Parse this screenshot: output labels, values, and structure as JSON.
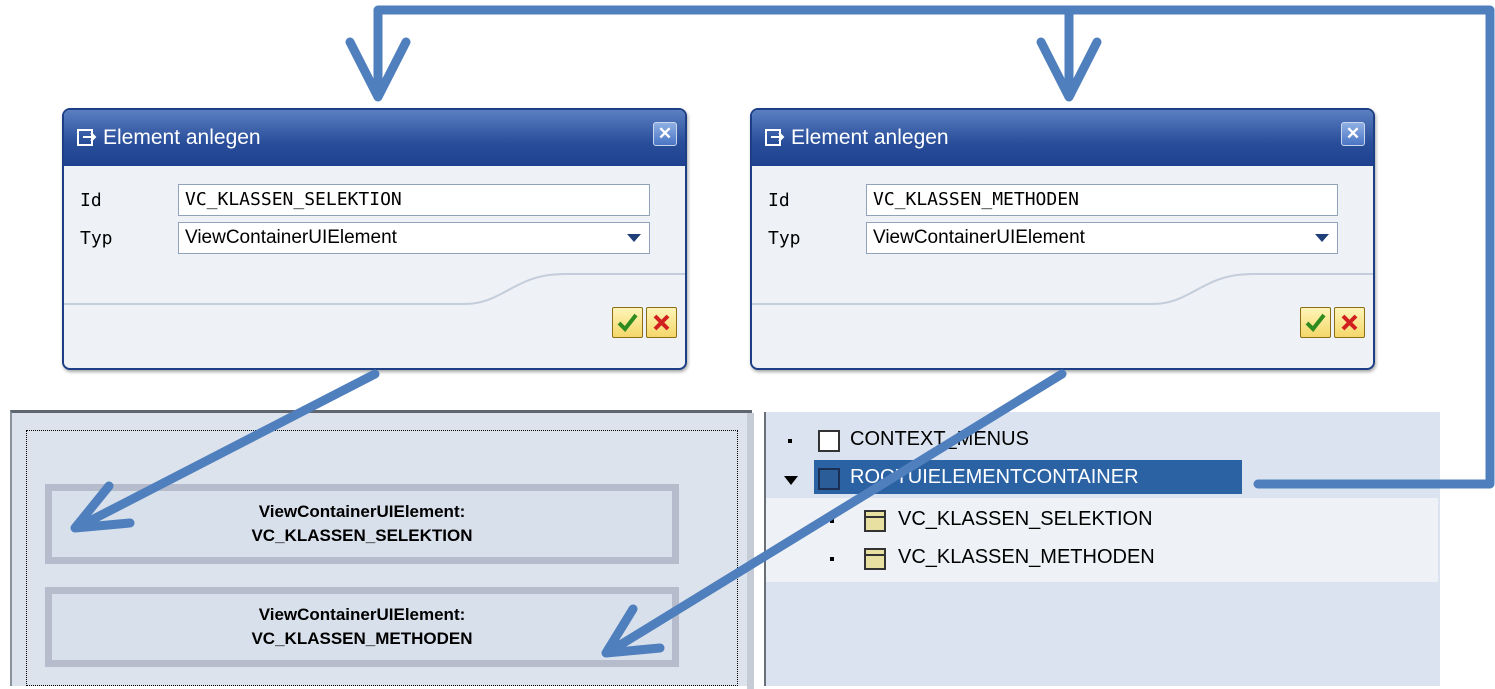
{
  "dialogs": [
    {
      "title": "Element anlegen",
      "close_glyph": "✕",
      "id_label": "Id",
      "id_value": "VC_KLASSEN_SELEKTION",
      "type_label": "Typ",
      "type_value": "ViewContainerUIElement"
    },
    {
      "title": "Element anlegen",
      "close_glyph": "✕",
      "id_label": "Id",
      "id_value": "VC_KLASSEN_METHODEN",
      "type_label": "Typ",
      "type_value": "ViewContainerUIElement"
    }
  ],
  "layout": {
    "containers": [
      {
        "line1": "ViewContainerUIElement:",
        "line2": "VC_KLASSEN_SELEKTION"
      },
      {
        "line1": "ViewContainerUIElement:",
        "line2": "VC_KLASSEN_METHODEN"
      }
    ]
  },
  "tree": {
    "nodes": [
      {
        "label": "CONTEXT_MENUS",
        "icon": "empty-box-icon"
      },
      {
        "label": "ROOTUIELEMENTCONTAINER",
        "icon": "container-icon",
        "selected": true,
        "expanded": true
      },
      {
        "label": "VC_KLASSEN_SELEKTION",
        "icon": "view-container-icon"
      },
      {
        "label": "VC_KLASSEN_METHODEN",
        "icon": "view-container-icon"
      }
    ]
  },
  "colors": {
    "arrow": "#4f7fbd",
    "dialog_title": "#284d99",
    "selection": "#2a62a3",
    "ok_check": "#2e8b1e",
    "cancel_x": "#d02020"
  }
}
